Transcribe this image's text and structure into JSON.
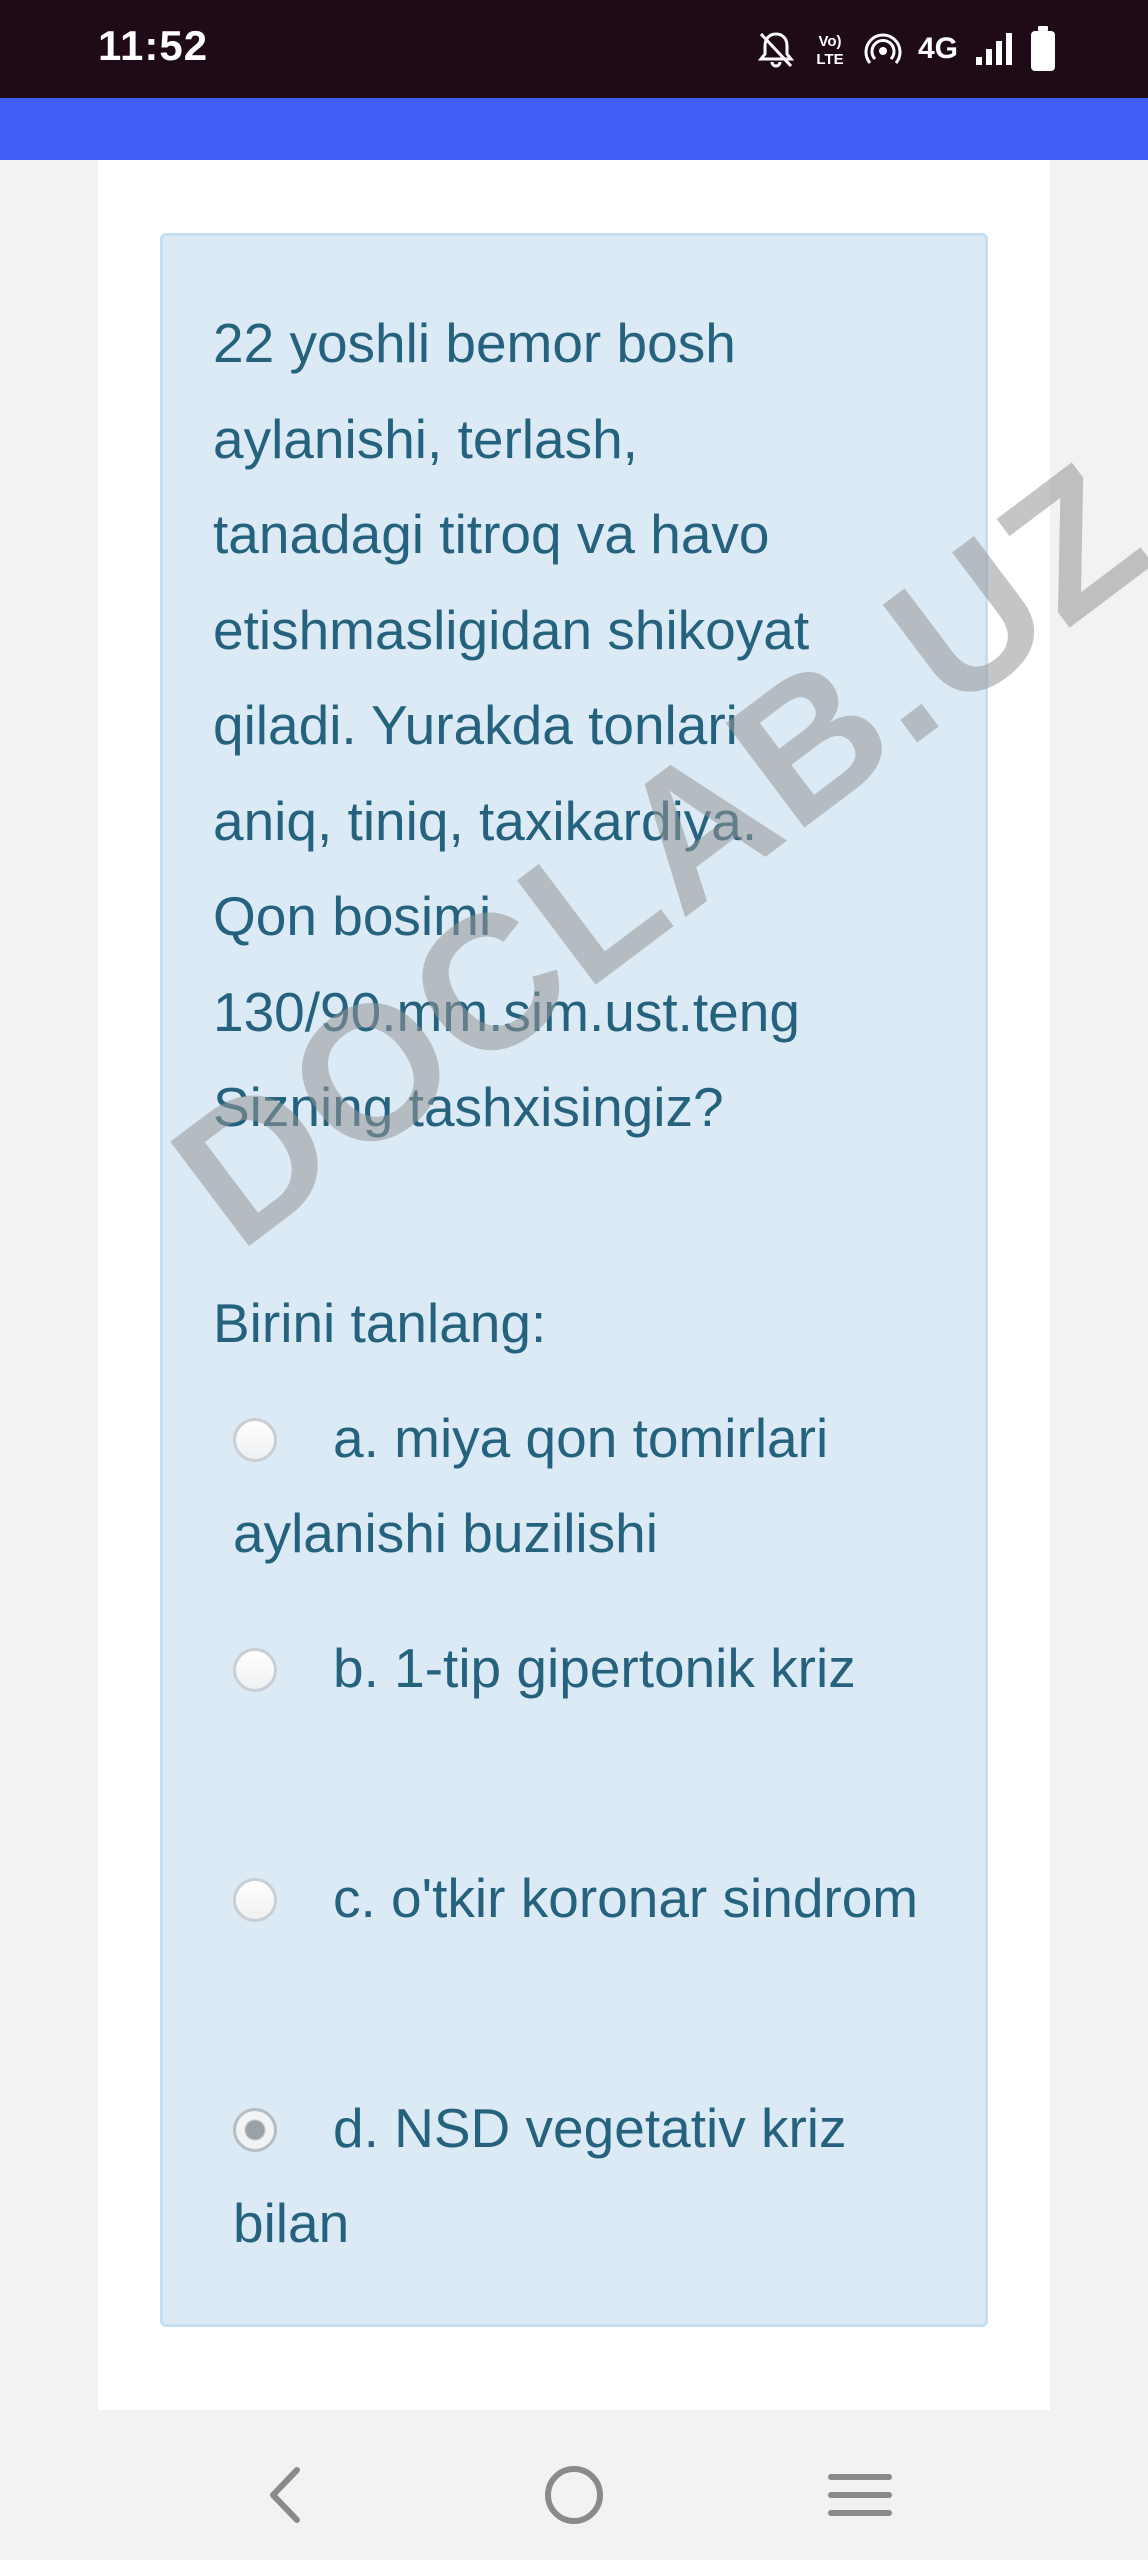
{
  "status_bar": {
    "time": "11:52",
    "network": "4G",
    "icons": [
      "bell-muted-icon",
      "volte-icon",
      "hotspot-icon",
      "signal-icon",
      "battery-icon"
    ]
  },
  "question": {
    "text": "22 yoshli bemor bosh\naylanishi, terlash,\ntanadagi titroq va havo\netishmasligidan shikoyat\nqiladi. Yurakda tonlari\naniq, tiniq, taxikardiya.\nQon bosimi\n130/90.mm.sim.ust.teng\nSizning tashxisingiz?",
    "prompt": "Birini tanlang:",
    "options": [
      {
        "label": "a. miya qon tomirlari aylanishi buzilishi",
        "selected": false
      },
      {
        "label": "b. 1-tip gipertonik kriz",
        "selected": false
      },
      {
        "label": "c. o'tkir koronar sindrom",
        "selected": false
      },
      {
        "label": "d. NSD vegetativ kriz bilan",
        "selected": true
      }
    ]
  },
  "watermark": "DOCLAB.UZ",
  "nav": {
    "icons": [
      "back-icon",
      "home-icon",
      "menu-icon"
    ]
  },
  "colors": {
    "status_bar": "#1f0a17",
    "accent": "#3f5ff6",
    "question_bg": "#dbeaf5",
    "question_text": "#24627e"
  }
}
